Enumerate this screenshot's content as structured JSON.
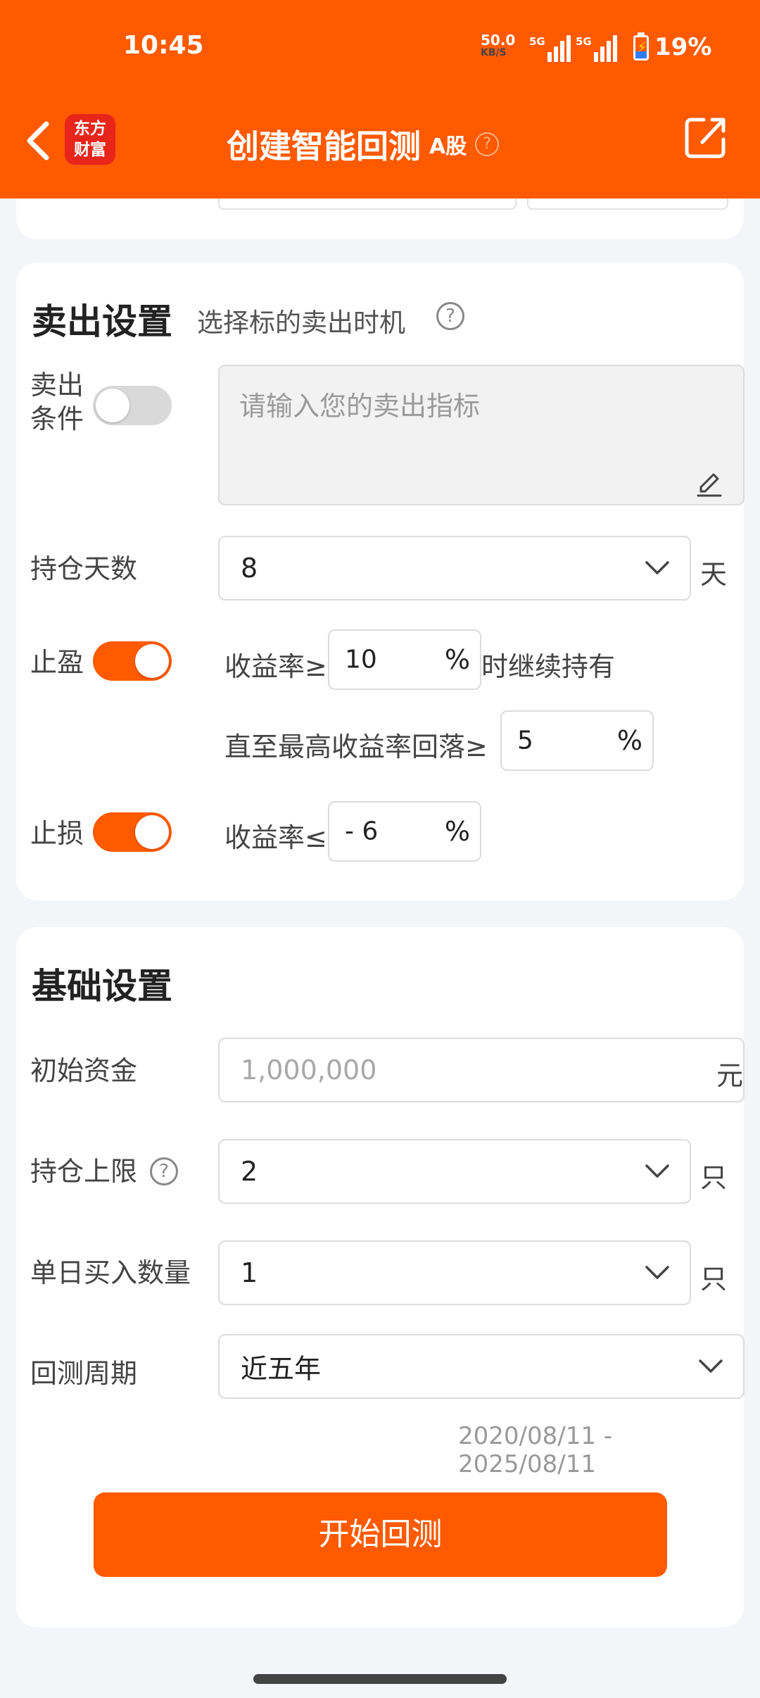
{
  "status_bar": {
    "time": "10:45",
    "net_speed_value": "50.0",
    "net_speed_unit": "KB/S",
    "sim1_tag": "5G",
    "sim2_tag": "5G",
    "battery_percent": "19%"
  },
  "header": {
    "logo_line1": "东方",
    "logo_line2": "财富",
    "title": "创建智能回测",
    "market_tag": "A股",
    "help_glyph": "?"
  },
  "sell_settings": {
    "title": "卖出设置",
    "description": "选择标的卖出时机",
    "help_glyph": "?",
    "condition_label_line1": "卖出",
    "condition_label_line2": "条件",
    "condition_placeholder": "请输入您的卖出指标",
    "hold_days_label": "持仓天数",
    "hold_days_value": "8",
    "hold_days_unit": "天",
    "take_profit_label": "止盈",
    "take_profit_return_label": "收益率≥",
    "take_profit_value": "10",
    "percent": "%",
    "take_profit_suffix": "时继续持有",
    "drawdown_label": "直至最高收益率回落≥",
    "drawdown_value": "5",
    "stop_loss_label": "止损",
    "stop_loss_return_label": "收益率≤",
    "stop_loss_value": "- 6"
  },
  "basic_settings": {
    "title": "基础设置",
    "initial_capital_label": "初始资金",
    "initial_capital_placeholder": "1,000,000",
    "initial_capital_unit": "元",
    "position_limit_label": "持仓上限",
    "help_glyph": "?",
    "position_limit_value": "2",
    "position_limit_unit": "只",
    "daily_buy_label": "单日买入数量",
    "daily_buy_value": "1",
    "daily_buy_unit": "只",
    "period_label": "回测周期",
    "period_value": "近五年",
    "date_range": "2020/08/11 - 2025/08/11",
    "start_button": "开始回测"
  },
  "colors": {
    "brand": "#ff5a00",
    "logo_red": "#e8251a",
    "background": "#f3f5f9"
  }
}
